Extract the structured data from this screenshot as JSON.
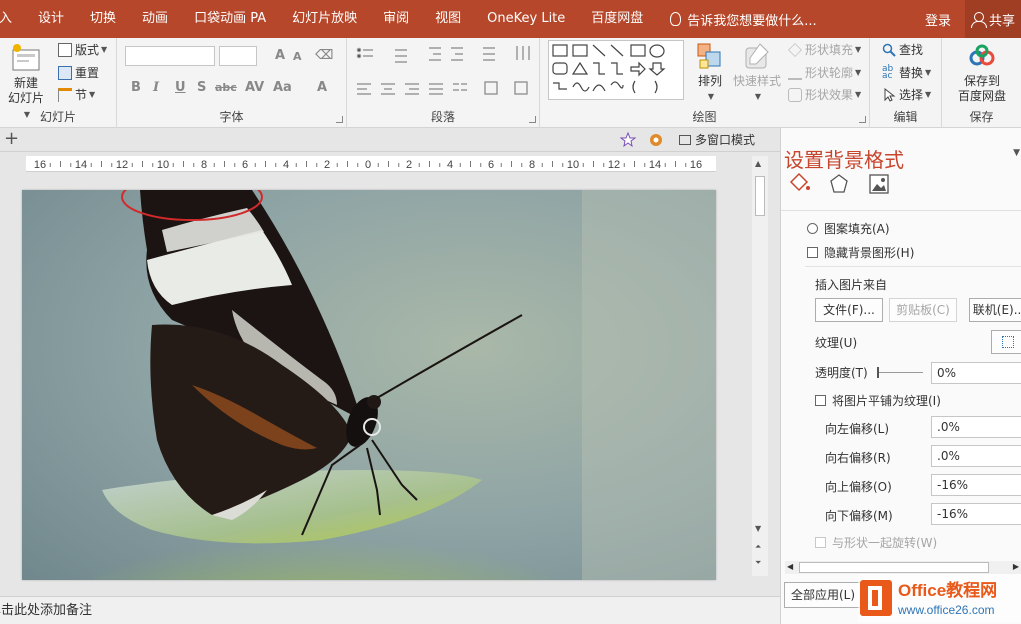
{
  "tabs": [
    "插入",
    "设计",
    "切换",
    "动画",
    "口袋动画 PA",
    "幻灯片放映",
    "审阅",
    "视图",
    "OneKey Lite",
    "百度网盘"
  ],
  "tell_me": "告诉我您想要做什么...",
  "login": "登录",
  "share": "共享",
  "ribbon": {
    "slides": {
      "new_slide": "新建",
      "new_slide2": "幻灯片",
      "layout": "版式",
      "reset": "重置",
      "section": "节",
      "label": "幻灯片"
    },
    "font": {
      "label": "字体",
      "bold": "B",
      "italic": "I",
      "underline": "U",
      "strike": "S",
      "spacing": "abc",
      "size_up": "A",
      "size_down": "A",
      "case": "Aa",
      "color": "A"
    },
    "paragraph": {
      "label": "段落"
    },
    "drawing": {
      "label": "绘图",
      "arrange": "排列",
      "quick_style": "快速样式",
      "shape_fill": "形状填充",
      "shape_outline": "形状轮廓",
      "shape_effect": "形状效果"
    },
    "editing": {
      "label": "编辑",
      "find": "查找",
      "replace": "替换",
      "select": "选择"
    },
    "save": {
      "label": "保存",
      "save_to": "保存到",
      "baidu": "百度网盘"
    }
  },
  "subbar": {
    "multi_window": "多窗口模式"
  },
  "ruler": {
    "ticks": [
      "16",
      "14",
      "12",
      "10",
      "8",
      "6",
      "4",
      "2",
      "0",
      "2",
      "4",
      "6",
      "8",
      "10",
      "12",
      "14",
      "16"
    ]
  },
  "notes_placeholder": "单击此处添加备注",
  "pane": {
    "title": "设置背景格式",
    "pattern_fill": "图案填充(A)",
    "hide_bg": "隐藏背景图形(H)",
    "insert_from": "插入图片来自",
    "file_btn": "文件(F)...",
    "clipboard_btn": "剪贴板(C)",
    "online_btn": "联机(E)...",
    "texture": "纹理(U)",
    "transparency": "透明度(T)",
    "transparency_val": "0%",
    "tile": "将图片平铺为纹理(I)",
    "left_offset": "向左偏移(L)",
    "left_val": ".0%",
    "right_offset": "向右偏移(R)",
    "right_val": ".0%",
    "top_offset": "向上偏移(O)",
    "top_val": "-16%",
    "bottom_offset": "向下偏移(M)",
    "bottom_val": "-16%",
    "rotate_with": "与形状一起旋转(W)",
    "apply_all": "全部应用(L)"
  },
  "watermark": {
    "brand": "Office教程网",
    "url": "www.office26.com"
  },
  "colors": {
    "accent": "#b7472a",
    "pane_title": "#c8452d"
  }
}
